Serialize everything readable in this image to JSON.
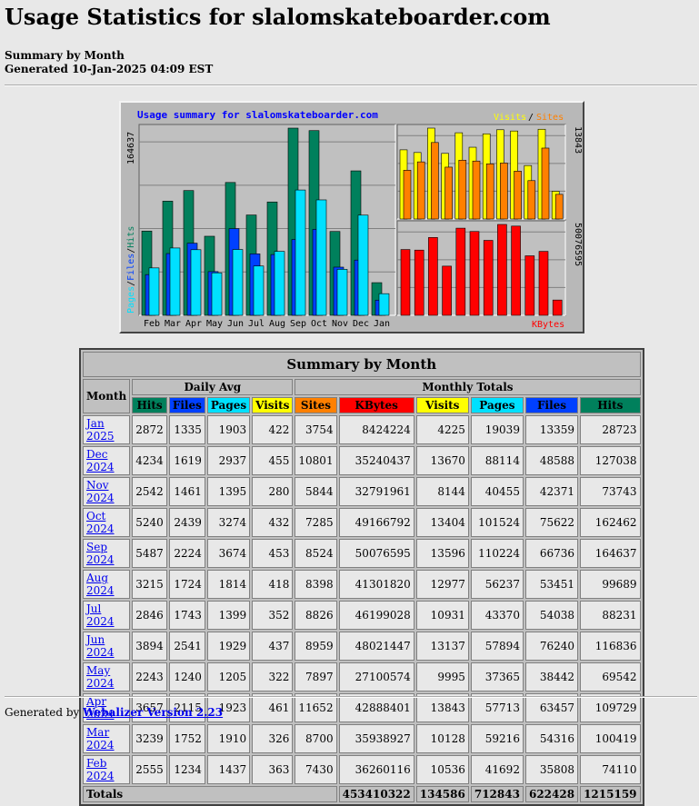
{
  "page": {
    "title": "Usage Statistics for slalomskateboarder.com",
    "subtitle": "Summary by Month",
    "generated": "Generated 10-Jan-2025 04:09 EST"
  },
  "chart_data": {
    "type": "bar",
    "title": "Usage summary for slalomskateboarder.com",
    "categories": [
      "Feb",
      "Mar",
      "Apr",
      "May",
      "Jun",
      "Jul",
      "Aug",
      "Sep",
      "Oct",
      "Nov",
      "Dec",
      "Jan"
    ],
    "left_axis_label_parts": [
      "Pages",
      "/",
      "Files",
      "/",
      "Hits"
    ],
    "left_axis_max_label": "164637",
    "right_top_max_label": "13843",
    "right_bottom_max_label": "50076595",
    "right_top_legend": [
      "Visits",
      "/",
      "Sites"
    ],
    "right_bottom_legend": "KBytes",
    "left_max": 164637,
    "visits_max": 13843,
    "kbytes_max": 50076595,
    "series": [
      {
        "name": "Hits",
        "values": [
          74110,
          100419,
          109729,
          69542,
          116836,
          88231,
          99689,
          164637,
          162462,
          73743,
          127038,
          28723
        ]
      },
      {
        "name": "Files",
        "values": [
          35808,
          54316,
          63457,
          38442,
          76240,
          54038,
          53451,
          66736,
          75622,
          42371,
          48588,
          13359
        ]
      },
      {
        "name": "Pages",
        "values": [
          41692,
          59216,
          57713,
          37365,
          57894,
          43370,
          56237,
          110224,
          101524,
          40455,
          88114,
          19039
        ]
      },
      {
        "name": "Visits",
        "values": [
          10536,
          10128,
          13843,
          9995,
          13137,
          10931,
          12977,
          13596,
          13404,
          8144,
          13670,
          4225
        ]
      },
      {
        "name": "Sites",
        "values": [
          7430,
          8700,
          11652,
          7897,
          8959,
          8826,
          8398,
          8524,
          7285,
          5844,
          10801,
          3754
        ]
      },
      {
        "name": "KBytes",
        "values": [
          36260116,
          35938927,
          42888401,
          27100574,
          48021447,
          46199028,
          41301820,
          50076595,
          49166792,
          32791961,
          35240437,
          8424224
        ]
      }
    ],
    "colors": {
      "hits": "#00805c",
      "files": "#0040ff",
      "pages": "#00e0ff",
      "visits": "#ffff00",
      "sites": "#ff8000",
      "kbytes": "#ff0000",
      "title": "#0000ff",
      "bg": "#c0c0c0"
    }
  },
  "table": {
    "title": "Summary by Month",
    "month_header": "Month",
    "daily_avg_header": "Daily Avg",
    "monthly_totals_header": "Monthly Totals",
    "daily_cols": [
      "Hits",
      "Files",
      "Pages",
      "Visits"
    ],
    "monthly_cols": [
      "Sites",
      "KBytes",
      "Visits",
      "Pages",
      "Files",
      "Hits"
    ],
    "rows": [
      {
        "month": "Jan 2025",
        "d_hits": "2872",
        "d_files": "1335",
        "d_pages": "1903",
        "d_visits": "422",
        "sites": "3754",
        "kbytes": "8424224",
        "visits": "4225",
        "pages": "19039",
        "files": "13359",
        "hits": "28723"
      },
      {
        "month": "Dec 2024",
        "d_hits": "4234",
        "d_files": "1619",
        "d_pages": "2937",
        "d_visits": "455",
        "sites": "10801",
        "kbytes": "35240437",
        "visits": "13670",
        "pages": "88114",
        "files": "48588",
        "hits": "127038"
      },
      {
        "month": "Nov 2024",
        "d_hits": "2542",
        "d_files": "1461",
        "d_pages": "1395",
        "d_visits": "280",
        "sites": "5844",
        "kbytes": "32791961",
        "visits": "8144",
        "pages": "40455",
        "files": "42371",
        "hits": "73743"
      },
      {
        "month": "Oct 2024",
        "d_hits": "5240",
        "d_files": "2439",
        "d_pages": "3274",
        "d_visits": "432",
        "sites": "7285",
        "kbytes": "49166792",
        "visits": "13404",
        "pages": "101524",
        "files": "75622",
        "hits": "162462"
      },
      {
        "month": "Sep 2024",
        "d_hits": "5487",
        "d_files": "2224",
        "d_pages": "3674",
        "d_visits": "453",
        "sites": "8524",
        "kbytes": "50076595",
        "visits": "13596",
        "pages": "110224",
        "files": "66736",
        "hits": "164637"
      },
      {
        "month": "Aug 2024",
        "d_hits": "3215",
        "d_files": "1724",
        "d_pages": "1814",
        "d_visits": "418",
        "sites": "8398",
        "kbytes": "41301820",
        "visits": "12977",
        "pages": "56237",
        "files": "53451",
        "hits": "99689"
      },
      {
        "month": "Jul 2024",
        "d_hits": "2846",
        "d_files": "1743",
        "d_pages": "1399",
        "d_visits": "352",
        "sites": "8826",
        "kbytes": "46199028",
        "visits": "10931",
        "pages": "43370",
        "files": "54038",
        "hits": "88231"
      },
      {
        "month": "Jun 2024",
        "d_hits": "3894",
        "d_files": "2541",
        "d_pages": "1929",
        "d_visits": "437",
        "sites": "8959",
        "kbytes": "48021447",
        "visits": "13137",
        "pages": "57894",
        "files": "76240",
        "hits": "116836"
      },
      {
        "month": "May 2024",
        "d_hits": "2243",
        "d_files": "1240",
        "d_pages": "1205",
        "d_visits": "322",
        "sites": "7897",
        "kbytes": "27100574",
        "visits": "9995",
        "pages": "37365",
        "files": "38442",
        "hits": "69542"
      },
      {
        "month": "Apr 2024",
        "d_hits": "3657",
        "d_files": "2115",
        "d_pages": "1923",
        "d_visits": "461",
        "sites": "11652",
        "kbytes": "42888401",
        "visits": "13843",
        "pages": "57713",
        "files": "63457",
        "hits": "109729"
      },
      {
        "month": "Mar 2024",
        "d_hits": "3239",
        "d_files": "1752",
        "d_pages": "1910",
        "d_visits": "326",
        "sites": "8700",
        "kbytes": "35938927",
        "visits": "10128",
        "pages": "59216",
        "files": "54316",
        "hits": "100419"
      },
      {
        "month": "Feb 2024",
        "d_hits": "2555",
        "d_files": "1234",
        "d_pages": "1437",
        "d_visits": "363",
        "sites": "7430",
        "kbytes": "36260116",
        "visits": "10536",
        "pages": "41692",
        "files": "35808",
        "hits": "74110"
      }
    ],
    "totals": {
      "label": "Totals",
      "kbytes": "453410322",
      "visits": "134586",
      "pages": "712843",
      "files": "622428",
      "hits": "1215159"
    }
  },
  "footer": {
    "prefix": "Generated by ",
    "link": "Webalizer Version 2.23"
  }
}
